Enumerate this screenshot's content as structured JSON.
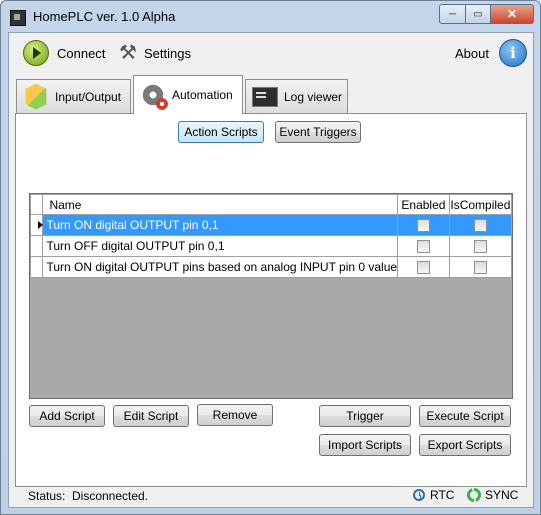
{
  "window": {
    "title": "HomePLC ver. 1.0 Alpha",
    "minimize_glyph": "─",
    "maximize_glyph": "▭",
    "close_glyph": "✕"
  },
  "toolbar": {
    "connect_label": "Connect",
    "settings_label": "Settings",
    "about_label": "About",
    "about_icon_glyph": "i",
    "settings_icon_glyph": "⚒"
  },
  "tabs": [
    {
      "label": "Input/Output",
      "icon": "input-output-icon",
      "active": false
    },
    {
      "label": "Automation",
      "icon": "gears-icon",
      "active": true
    },
    {
      "label": "Log viewer",
      "icon": "console-icon",
      "active": false
    }
  ],
  "subtabs": {
    "action_scripts": "Action Scripts",
    "event_triggers": "Event Triggers",
    "selected": "Action Scripts"
  },
  "grid": {
    "columns": {
      "name": "Name",
      "enabled": "Enabled",
      "compiled": "IsCompiled"
    },
    "rows": [
      {
        "name": "Turn ON digital OUTPUT pin 0,1",
        "enabled": false,
        "compiled": false,
        "selected": true
      },
      {
        "name": "Turn OFF digital OUTPUT pin 0,1",
        "enabled": false,
        "compiled": false,
        "selected": false
      },
      {
        "name": "Turn ON digital OUTPUT pins based on analog INPUT pin 0 value",
        "enabled": false,
        "compiled": false,
        "selected": false
      }
    ]
  },
  "buttons": {
    "add_script": "Add Script",
    "edit_script": "Edit Script",
    "remove": "Remove",
    "trigger": "Trigger",
    "execute_script": "Execute Script",
    "import_scripts": "Import Scripts",
    "export_scripts": "Export Scripts"
  },
  "status": {
    "label": "Status:",
    "value": "Disconnected.",
    "rtc_label": "RTC",
    "sync_label": "SYNC"
  },
  "colors": {
    "selection": "#3399ff",
    "title_bar": "#c3d5ea",
    "close_button": "#c9462c"
  }
}
